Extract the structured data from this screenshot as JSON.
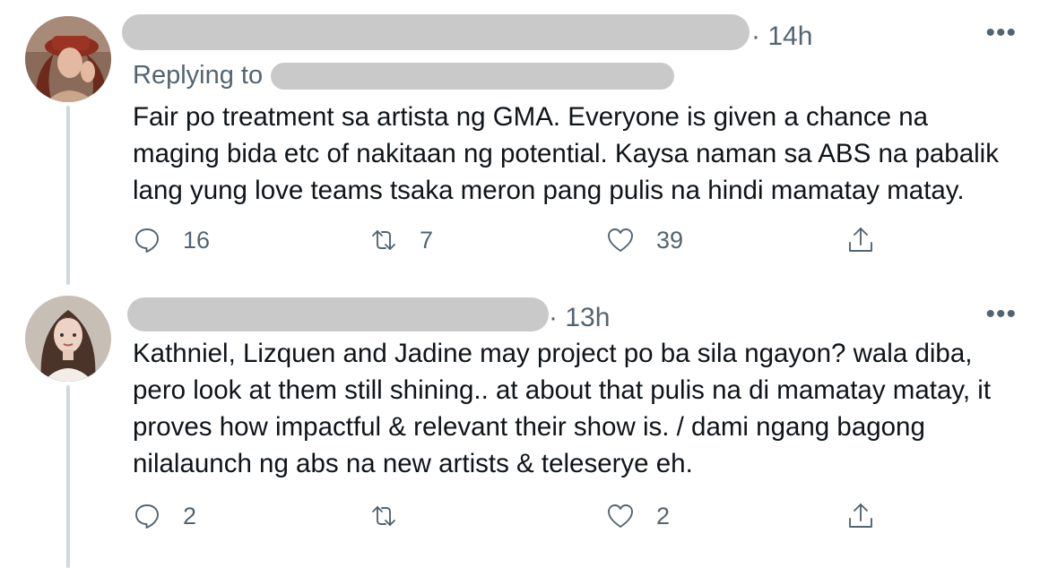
{
  "tweets": [
    {
      "time": "· 14h",
      "replying_label": "Replying to",
      "text": "Fair po treatment sa artista ng GMA. Everyone is given a chance na maging bida etc of nakitaan ng potential. Kaysa naman sa ABS na pabalik lang yung love teams tsaka meron pang pulis na hindi mamatay matay.",
      "reply_count": "16",
      "retweet_count": "7",
      "like_count": "39",
      "more_icon": "•••"
    },
    {
      "time": "· 13h",
      "text": "Kathniel, Lizquen and Jadine may project po ba sila ngayon? wala diba, pero look at them still shining.. at about that pulis na di mamatay matay, it proves how impactful & relevant their show is. / dami ngang bagong nilalaunch ng abs na new artists & teleserye eh.",
      "reply_count": "2",
      "retweet_count": "",
      "like_count": "2",
      "more_icon": "•••"
    }
  ],
  "icons": {
    "reply": "reply-icon",
    "retweet": "retweet-icon",
    "like": "heart-icon",
    "share": "share-icon",
    "more": "more-icon"
  },
  "colors": {
    "secondary_text": "#536471",
    "primary_text": "#0f1419",
    "thread_line": "#cfd9de",
    "redaction": "#c9c9c9"
  }
}
